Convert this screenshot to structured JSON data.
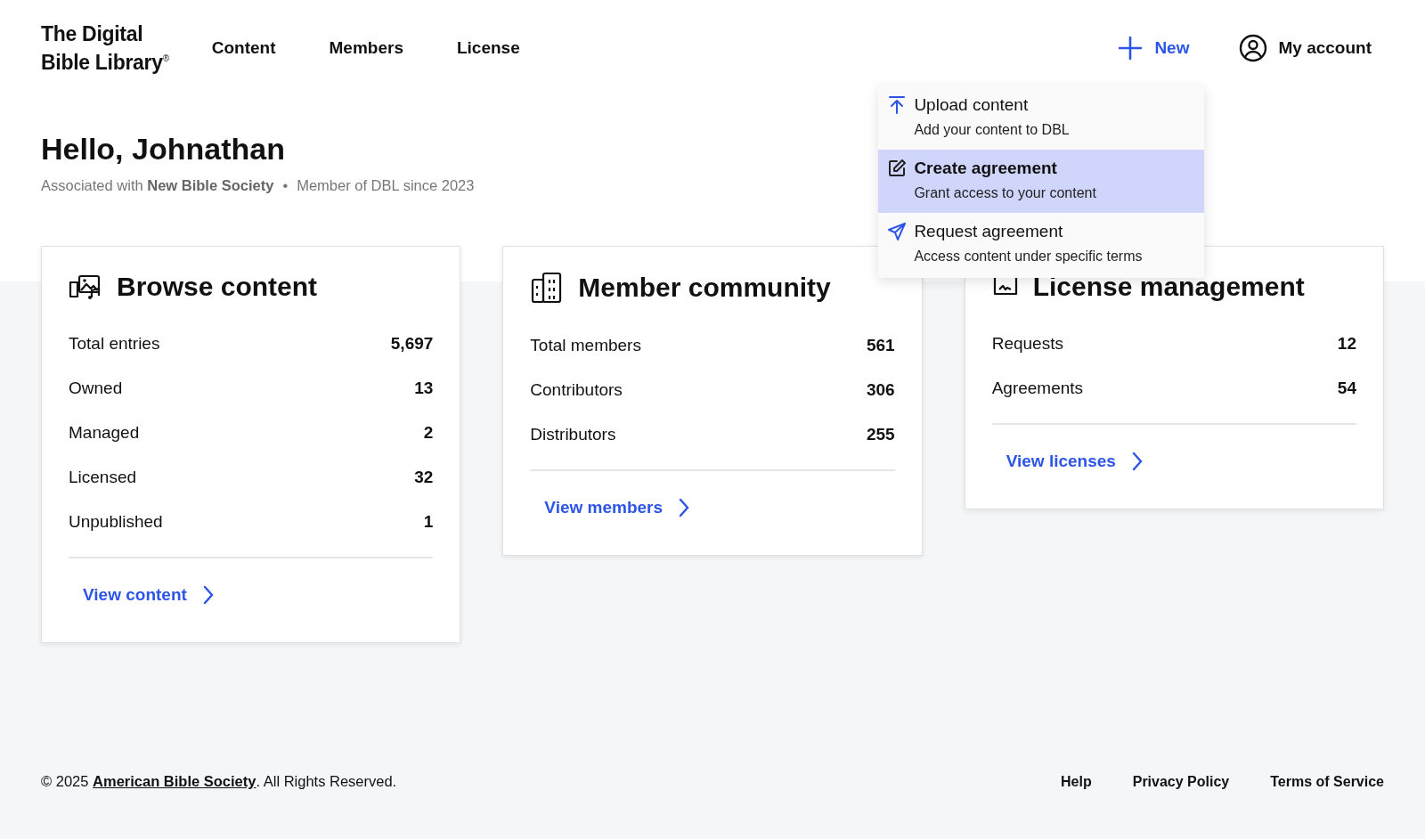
{
  "logo": {
    "line_1": "The Digital",
    "line_2": "Bible Library",
    "mark": "®"
  },
  "nav": [
    {
      "label": "Content"
    },
    {
      "label": "Members"
    },
    {
      "label": "License"
    }
  ],
  "new_button": {
    "label": "New",
    "expanded": true
  },
  "account": {
    "label": "My account"
  },
  "new_menu": [
    {
      "kind": "upload",
      "title": "Upload content",
      "subtitle": "Add your content to DBL",
      "selected": false
    },
    {
      "kind": "edit",
      "title": "Create agreement",
      "subtitle": "Grant access to your content",
      "selected": true
    },
    {
      "kind": "send",
      "title": "Request agreement",
      "subtitle": "Access content under specific terms",
      "selected": false
    }
  ],
  "greeting": "Hello, Johnathan",
  "association": {
    "prefix": "Associated with",
    "organization": "New Bible Society",
    "separator": "•",
    "member_since": "Member of DBL since 2023"
  },
  "cards": [
    {
      "kind": "content",
      "title": "Browse content",
      "rows": [
        {
          "label": "Total entries",
          "value": "5,697"
        },
        {
          "label": "Owned",
          "value": "13"
        },
        {
          "label": "Managed",
          "value": "2"
        },
        {
          "label": "Licensed",
          "value": "32"
        },
        {
          "label": "Unpublished",
          "value": "1"
        }
      ],
      "link": "View content"
    },
    {
      "kind": "members",
      "title": "Member community",
      "rows": [
        {
          "label": "Total members",
          "value": "561"
        },
        {
          "label": "Contributors",
          "value": "306"
        },
        {
          "label": "Distributors",
          "value": "255"
        }
      ],
      "link": "View members"
    },
    {
      "kind": "license",
      "title": "License management",
      "rows": [
        {
          "label": "Requests",
          "value": "12"
        },
        {
          "label": "Agreements",
          "value": "54"
        }
      ],
      "link": "View licenses"
    }
  ],
  "footer": {
    "copyright_prefix": "© 2025",
    "organization_link": "American Bible Society",
    "copyright_suffix": ". All Rights Reserved.",
    "links": [
      "Help",
      "Privacy Policy",
      "Terms of Service"
    ]
  }
}
